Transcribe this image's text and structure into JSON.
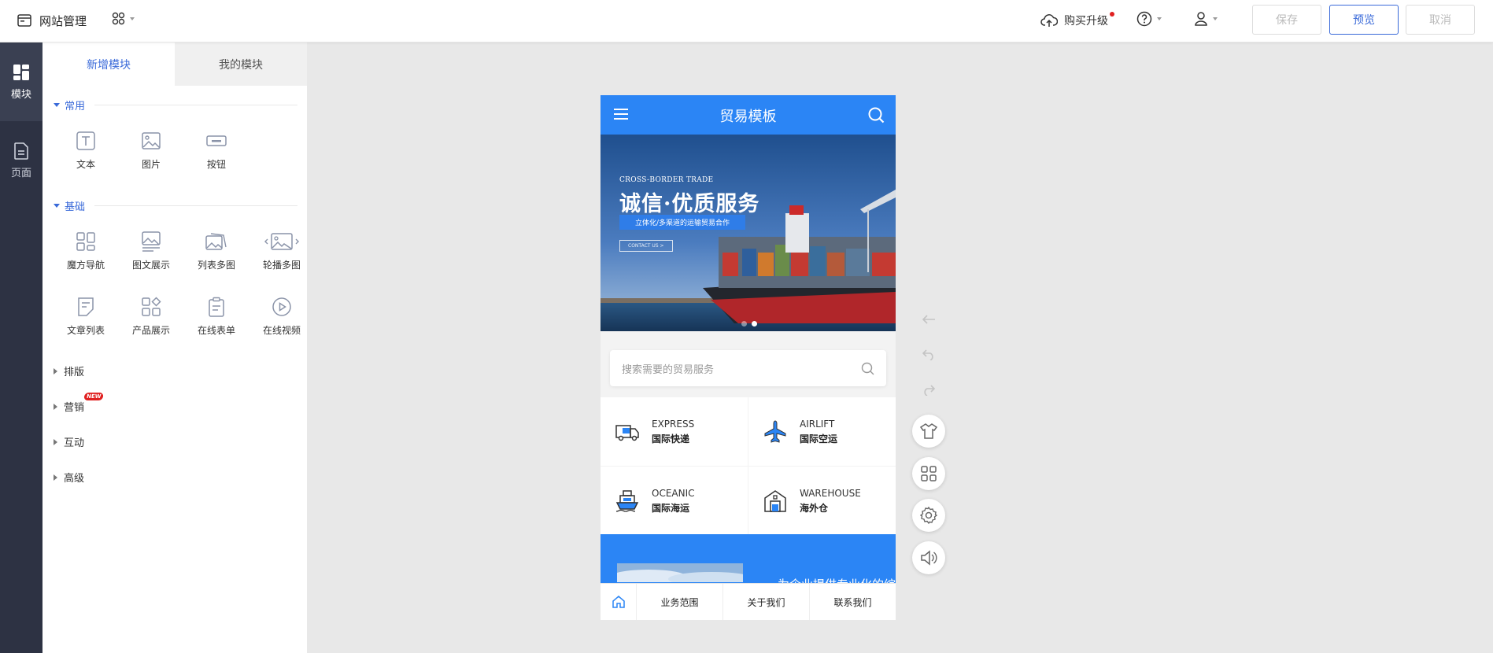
{
  "topbar": {
    "title": "网站管理",
    "upgrade_label": "购买升级",
    "save_label": "保存",
    "preview_label": "预览",
    "cancel_label": "取消"
  },
  "sidebar": {
    "items": [
      {
        "label": "模块",
        "icon": "modules-icon",
        "active": true
      },
      {
        "label": "页面",
        "icon": "page-icon",
        "active": false
      }
    ]
  },
  "panel": {
    "tabs": [
      {
        "label": "新增模块",
        "active": true
      },
      {
        "label": "我的模块",
        "active": false
      }
    ],
    "sections": [
      {
        "title": "常用",
        "expanded": true,
        "items": [
          {
            "label": "文本",
            "icon": "text-icon"
          },
          {
            "label": "图片",
            "icon": "image-icon"
          },
          {
            "label": "按钮",
            "icon": "button-icon"
          }
        ]
      },
      {
        "title": "基础",
        "expanded": true,
        "items": [
          {
            "label": "魔方导航",
            "icon": "grid-nav-icon"
          },
          {
            "label": "图文展示",
            "icon": "image-text-icon"
          },
          {
            "label": "列表多图",
            "icon": "list-images-icon"
          },
          {
            "label": "轮播多图",
            "icon": "carousel-icon"
          },
          {
            "label": "文章列表",
            "icon": "article-list-icon"
          },
          {
            "label": "产品展示",
            "icon": "product-icon"
          },
          {
            "label": "在线表单",
            "icon": "form-icon"
          },
          {
            "label": "在线视频",
            "icon": "video-icon"
          }
        ]
      }
    ],
    "collapsed_sections": [
      {
        "title": "排版"
      },
      {
        "title": "营销",
        "badge": "NEW"
      },
      {
        "title": "互动"
      },
      {
        "title": "高级"
      }
    ]
  },
  "phone": {
    "header_title": "贸易模板",
    "banner": {
      "small": "CROSS-BORDER TRADE",
      "big": "诚信·优质服务",
      "pill": "立体化/多渠道的运输贸易合作",
      "cta": "CONTACT US >"
    },
    "search_placeholder": "搜索需要的贸易服务",
    "services": [
      {
        "en": "EXPRESS",
        "cn": "国际快递",
        "icon": "truck-icon"
      },
      {
        "en": "AIRLIFT",
        "cn": "国际空运",
        "icon": "airplane-icon"
      },
      {
        "en": "OCEANIC",
        "cn": "国际海运",
        "icon": "ship-icon"
      },
      {
        "en": "WAREHOUSE",
        "cn": "海外仓",
        "icon": "warehouse-icon"
      }
    ],
    "blue_section_title": "为企业提供专业化的综合服务",
    "bottom_nav": [
      {
        "label": "",
        "icon": "home-icon"
      },
      {
        "label": "业务范围"
      },
      {
        "label": "关于我们"
      },
      {
        "label": "联系我们"
      }
    ]
  },
  "colors": {
    "accent": "#3a6ad9",
    "phone_blue": "#2b85f5",
    "sidebar_bg": "#2d3243"
  }
}
